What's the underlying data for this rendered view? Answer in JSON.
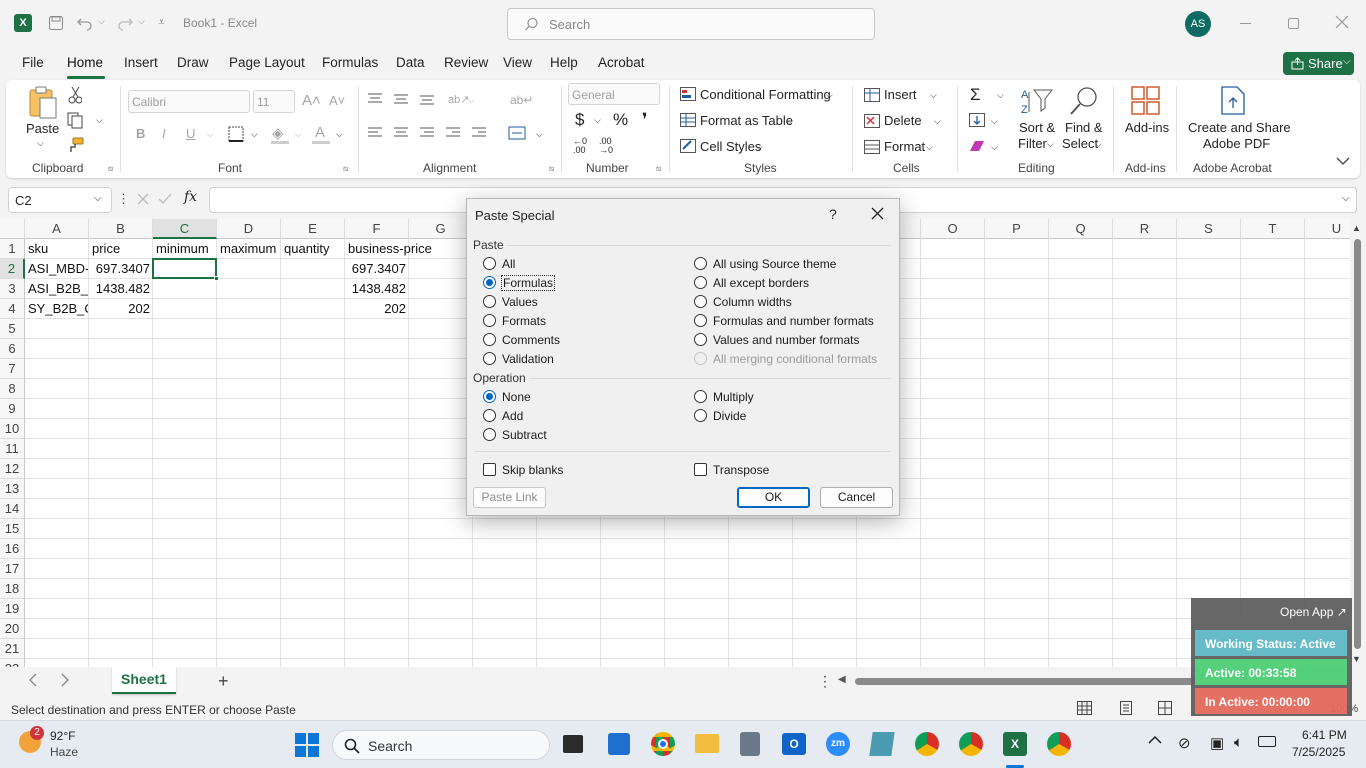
{
  "titlebar": {
    "doc_title": "Book1 - Excel",
    "search_placeholder": "Search",
    "avatar": "AS"
  },
  "menu": {
    "tabs": [
      "File",
      "Home",
      "Insert",
      "Draw",
      "Page Layout",
      "Formulas",
      "Data",
      "Review",
      "View",
      "Help",
      "Acrobat"
    ],
    "share": "Share"
  },
  "ribbon": {
    "clipboard": {
      "paste": "Paste",
      "group": "Clipboard"
    },
    "font": {
      "name": "Calibri",
      "size": "11",
      "group": "Font"
    },
    "alignment": {
      "group": "Alignment"
    },
    "number": {
      "format": "General",
      "group": "Number"
    },
    "styles": {
      "conditional": "Conditional Formatting",
      "as_table": "Format as Table",
      "cell_styles": "Cell Styles",
      "group": "Styles"
    },
    "cells": {
      "insert": "Insert",
      "delete": "Delete",
      "format": "Format",
      "group": "Cells"
    },
    "editing": {
      "sort1": "Sort &",
      "sort2": "Filter",
      "find1": "Find &",
      "find2": "Select",
      "group": "Editing"
    },
    "addins": {
      "label": "Add-ins",
      "group": "Add-ins"
    },
    "acrobat": {
      "line1": "Create and Share",
      "line2": "Adobe PDF",
      "group": "Adobe Acrobat"
    }
  },
  "formula_bar": {
    "name_box": "C2",
    "fx": "fx",
    "value": ""
  },
  "grid": {
    "columns": [
      "A",
      "B",
      "C",
      "D",
      "E",
      "F",
      "G",
      "H",
      "I",
      "J",
      "K",
      "L",
      "M",
      "N",
      "O",
      "P",
      "Q",
      "R",
      "S",
      "T",
      "U"
    ],
    "rows": [
      "1",
      "2",
      "3",
      "4",
      "5",
      "6",
      "7",
      "8",
      "9",
      "10",
      "11",
      "12",
      "13",
      "14",
      "15",
      "16",
      "17",
      "18",
      "19",
      "20",
      "21",
      "22"
    ],
    "cells": {
      "A1": "sku",
      "B1": "price",
      "C1": "minimum",
      "D1": "maximum",
      "E1": "quantity",
      "F1": "business-price",
      "A2": "ASI_MBD-",
      "B2": "697.3407",
      "F2": "697.3407",
      "A3": "ASI_B2B_\\",
      "B3": "1438.482",
      "F3": "1438.482",
      "A4": "SY_B2B_O",
      "B4": "202",
      "F4": "202"
    }
  },
  "sheets": {
    "tabs": [
      "Sheet1"
    ],
    "active": "Sheet1"
  },
  "status": {
    "message": "Select destination and press ENTER or choose Paste",
    "zoom": "100%"
  },
  "dialog": {
    "title": "Paste Special",
    "help": "?",
    "paste_label": "Paste",
    "paste_left": [
      "All",
      "Formulas",
      "Values",
      "Formats",
      "Comments",
      "Validation"
    ],
    "paste_right": [
      "All using Source theme",
      "All except borders",
      "Column widths",
      "Formulas and number formats",
      "Values and number formats",
      "All merging conditional formats"
    ],
    "paste_selected": "Formulas",
    "operation_label": "Operation",
    "op_left": [
      "None",
      "Add",
      "Subtract"
    ],
    "op_right": [
      "Multiply",
      "Divide"
    ],
    "op_selected": "None",
    "skip_blanks": "Skip blanks",
    "transpose": "Transpose",
    "paste_link": "Paste Link",
    "ok": "OK",
    "cancel": "Cancel"
  },
  "widget": {
    "open_app": "Open App ↗",
    "working": "Working Status: Active",
    "active": "Active: 00:33:58",
    "inactive": "In Active: 00:00:00"
  },
  "taskbar": {
    "weather_temp": "92°F",
    "weather_desc": "Haze",
    "weather_badge": "2",
    "search": "Search",
    "time": "6:41 PM",
    "date": "7/25/2025"
  },
  "colors": {
    "excel_green": "#1e7145",
    "accent_blue": "#0067c0",
    "working": "#5fb8c6",
    "active": "#4ccf76",
    "inactive": "#e36a5c"
  }
}
